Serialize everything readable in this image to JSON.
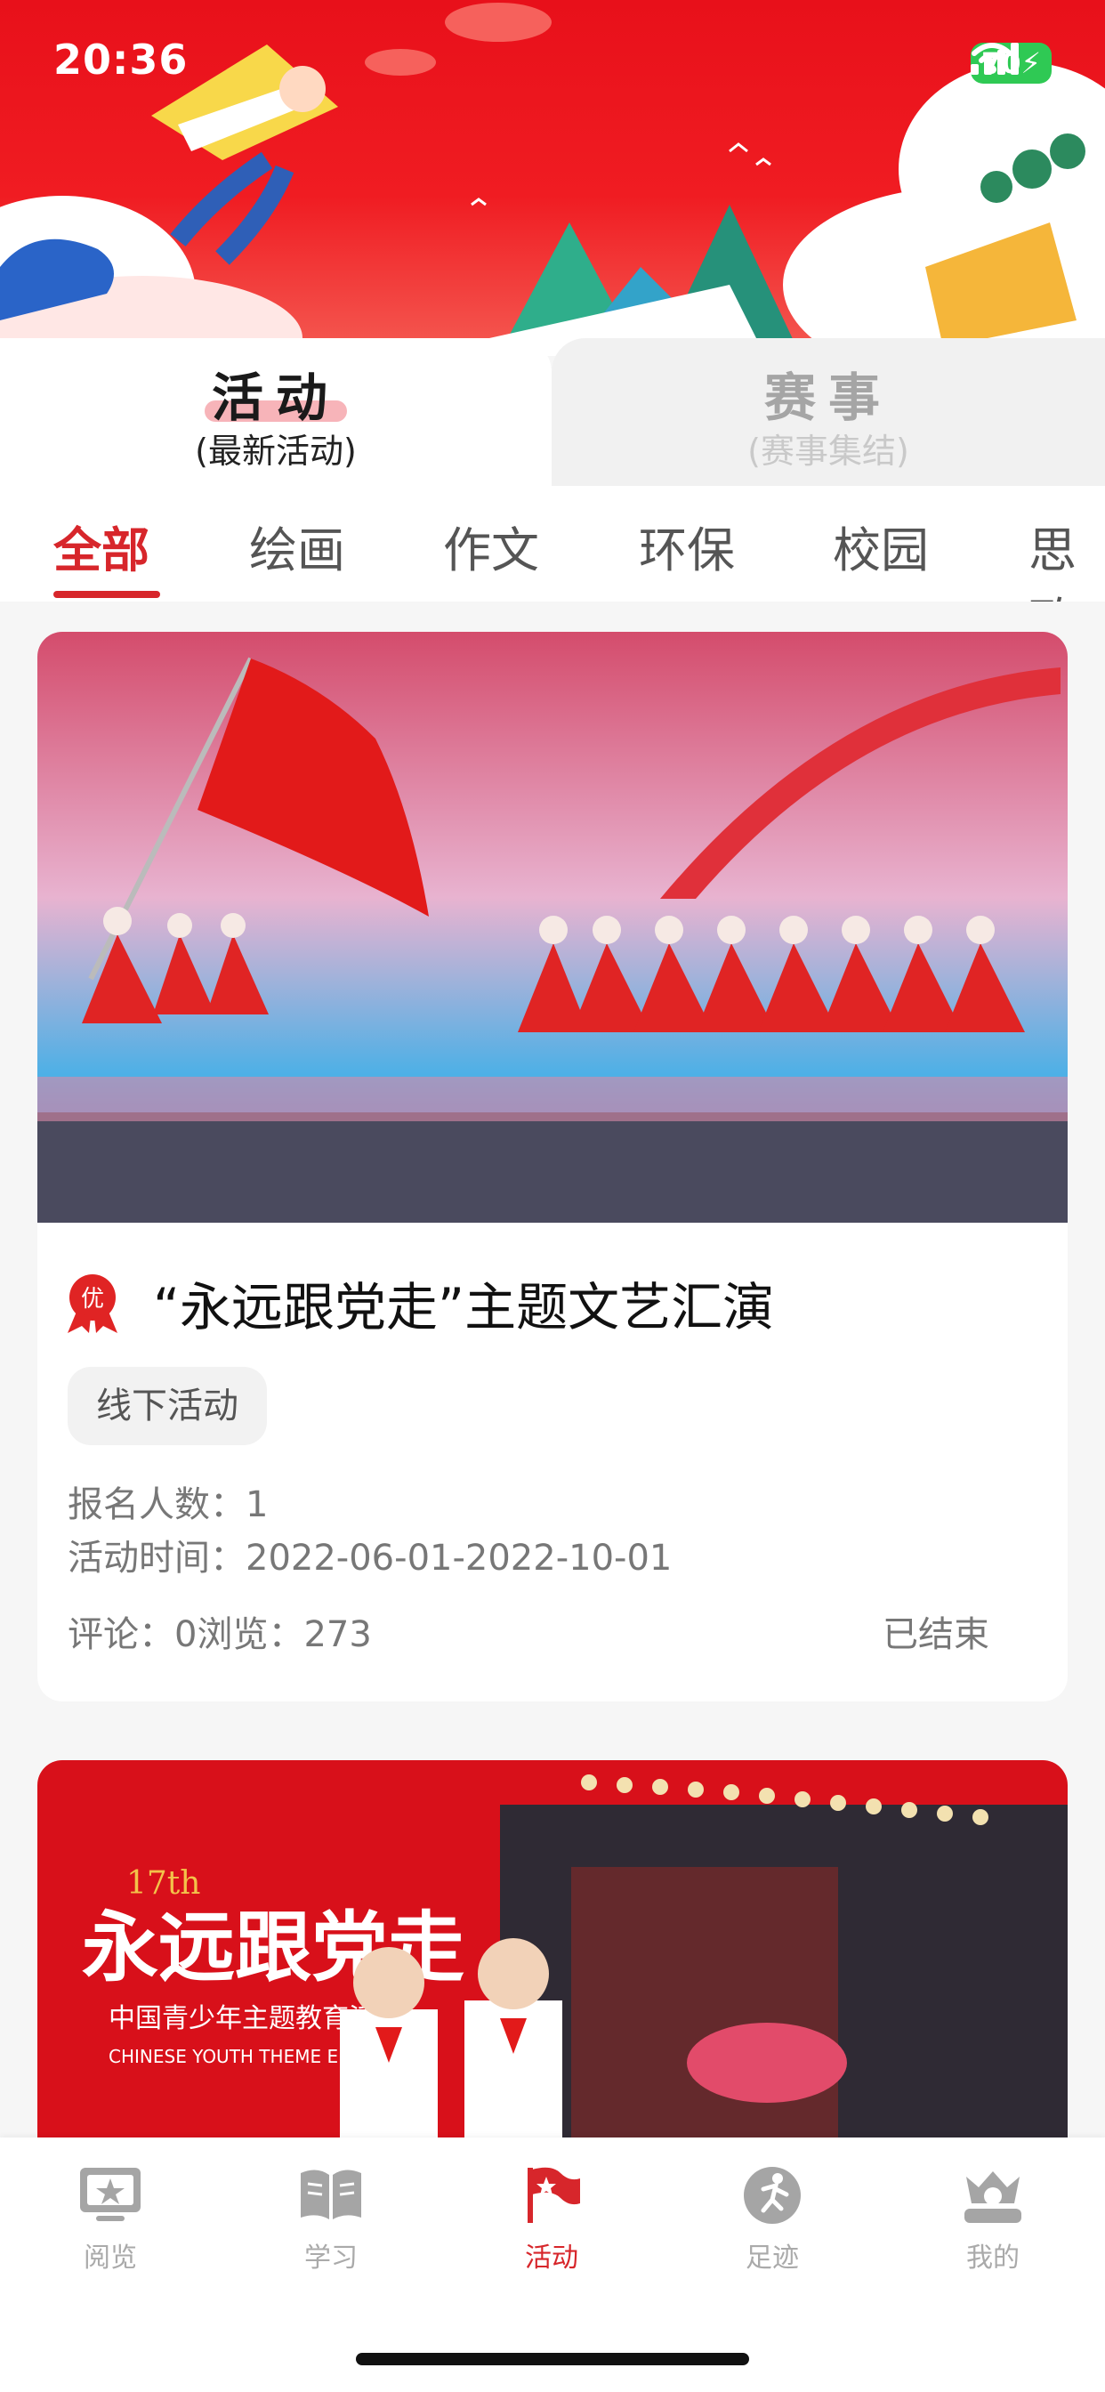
{
  "status": {
    "time": "20:36",
    "battery": "70"
  },
  "top_tabs": [
    {
      "label": "活动",
      "sub": "(最新活动)"
    },
    {
      "label": "赛事",
      "sub": "(赛事集结)"
    }
  ],
  "categories": [
    "全部",
    "绘画",
    "作文",
    "环保",
    "校园",
    "思政"
  ],
  "cards": [
    {
      "badge": "优",
      "title": "“永远跟党走”主题文艺汇演",
      "tag": "线下活动",
      "signup_label": "报名人数：",
      "signup_count": "1",
      "time_label": "活动时间：",
      "time_range": "2022-06-01-2022-10-01",
      "comments_label": "评论：",
      "comments": "0",
      "views_label": "浏览：",
      "views": "273",
      "status": "已结束"
    },
    {
      "image_text": {
        "edition": "17th",
        "slogan": "永远跟党走",
        "subtitle": "中国青少年主题教育活动",
        "english": "CHINESE YOUTH THEME EDUCATION"
      }
    }
  ],
  "bottom_nav": [
    {
      "label": "阅览",
      "icon": "reading-icon"
    },
    {
      "label": "学习",
      "icon": "book-icon"
    },
    {
      "label": "活动",
      "icon": "flag-icon"
    },
    {
      "label": "足迹",
      "icon": "runner-icon"
    },
    {
      "label": "我的",
      "icon": "crown-user-icon"
    }
  ],
  "colors": {
    "brand_red": "#d7262b",
    "banner_red": "#e8101a"
  }
}
